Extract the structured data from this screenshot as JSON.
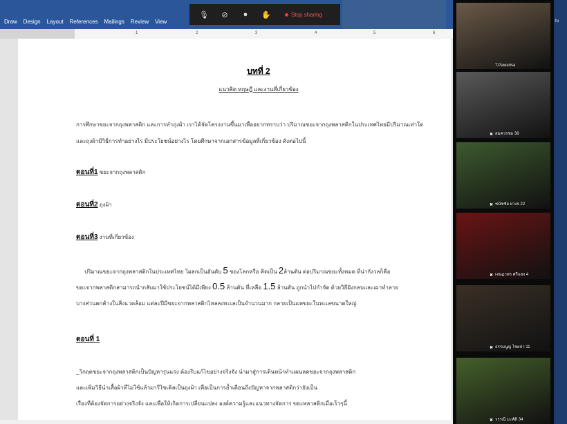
{
  "ribbon": {
    "tabs": [
      "Draw",
      "Design",
      "Layout",
      "References",
      "Mailings",
      "Review",
      "View"
    ]
  },
  "share_bar": {
    "stop_label": "Stop sharing"
  },
  "ruler": {
    "numbers": [
      "1",
      "2",
      "3",
      "4",
      "5",
      "6"
    ]
  },
  "document": {
    "title_prefix": "บทที่",
    "title_number": "2",
    "subtitle": "แนวคิด ทฤษฎี และงานที่เกี่ยวข้อง",
    "intro_line1": "การศึกษาขยะจากถุงพลาสติก และการทำถุงผ้า เราได้จัดโครงงานขึ้นมาเพื่ออยากทราบว่า ปริมาณขยะจากถุงพลาสติกในประเทศไทยมีปริมาณเท่าใด",
    "intro_line2": "และถุงผ้ามีวิธีการทำอย่างไร มีประโยชน์อย่างไร โดยศึกษาจากเอกสารข้อมูลที่เกี่ยวข้อง ดังต่อไปนี้",
    "sections": [
      {
        "label": "ตอนที่",
        "num": "1",
        "text": "ขยะจากถุงพลาสติก"
      },
      {
        "label": "ตอนที่",
        "num": "2",
        "text": "ถุงผ้า"
      },
      {
        "label": "ตอนที่",
        "num": "3",
        "text": "งานที่เกี่ยวข้อง"
      }
    ],
    "para": {
      "l1_a": "ปริมาณขยะจากถุงพลาสติกในประเทศไทย โผลกเป็นอันดับ",
      "l1_n1": "5",
      "l1_b": "ของโลกหรือ คิดเป็น",
      "l1_n2": "2",
      "l1_c": "ล้านตัน ต่อปริมาณขยะทั้งหมด ที่น่ากังวลก็คือ",
      "l2_a": "ขยะจากพลาสติกสามารถนำกลับมาใช้ประโยชน์ได้มีเพียง",
      "l2_n1": "0.5",
      "l2_b": "ล้านตัน ที่เหลือ",
      "l2_n2": "1.5",
      "l2_c": "ล้านตัน ถูกนำไปกำจัด ด้วยวิธีฝังกลบและเผาทำลาย",
      "l3": "บางส่วนตกค้างในสิ่งแวดล้อม แต่ละปีมีขยะจากพลาสติกไหลลงทะเลเป็นจำนวนมาก กลายเป็นแพขยะในทะเลขนาดใหญ่"
    },
    "section_heading": {
      "label": "ตอนที่",
      "num": "1"
    },
    "bottom": {
      "l1": "_วิกฤตขยะจากถุงพลาสติกเป็นปัญหารุนแรง ต้องรีบแก้ไขอย่างจริงจัง นำมาสู่การเดินหน้าทำแผนลดขยะจากถุงพลาสติก",
      "l2": "และเพิ่มวิธีนำเสื้อผ้าที่ไม่ใช้แล้วมารีไซเคิลเป็นถุงผ้า เพื่อเป็นการย้ำเตือนถึงปัญหาจากพลาสติกว่ายังเป็น",
      "l3": "เรื่องที่ต้องจัดการอย่างจริงจัง และเพื่อให้เกิดการเปลี่ยนแปลง องค์ความรู้และแนวทางจัดการ ขยะพลาสติกเมื่อเร็วๆนี้"
    }
  },
  "participants": [
    {
      "name": "T.Pawarisa",
      "color": "#6b5a48"
    },
    {
      "name": "สมควรชม 38",
      "color": "#5a5a5a"
    },
    {
      "name": "ชนัชชัย ยางจ 22",
      "color": "#3d5a2e"
    },
    {
      "name": "เจษฎาพร ศรีแสง 4",
      "color": "#6a1414"
    },
    {
      "name": "ธรรมนูญ ไชยปา 11",
      "color": "#3a3026"
    },
    {
      "name": "วรรณี มะพัติ 34",
      "color": "#45602a"
    }
  ]
}
